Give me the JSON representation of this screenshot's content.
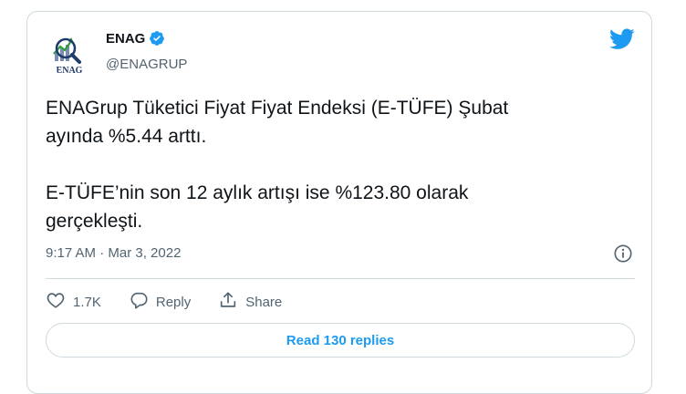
{
  "author": {
    "display_name": "ENAG",
    "handle": "@ENAGRUP",
    "logo_text": "ENAG",
    "avatar_icon": "enag-logo-magnifier-chart-icon",
    "verified_icon": "verified-badge-icon"
  },
  "tweet": {
    "text": "ENAGrup Tüketici Fiyat Fiyat Endeksi (E-TÜFE) Şubat\nayında %5.44 arttı.\n\nE-TÜFE’nin son 12 aylık artışı ise %123.80 olarak\ngerçekleşti.",
    "timestamp": "9:17 AM · Mar 3, 2022"
  },
  "actions": {
    "like_count": "1.7K",
    "reply_label": "Reply",
    "share_label": "Share"
  },
  "read_replies_label": "Read 130 replies",
  "colors": {
    "accent": "#1d9bf0",
    "text": "#0f1419",
    "secondary": "#536471",
    "border": "#cfd9de"
  },
  "icons": {
    "brand": "twitter-bird-icon",
    "info": "info-icon",
    "like": "heart-icon",
    "reply": "reply-bubble-icon",
    "share": "share-upload-icon"
  }
}
